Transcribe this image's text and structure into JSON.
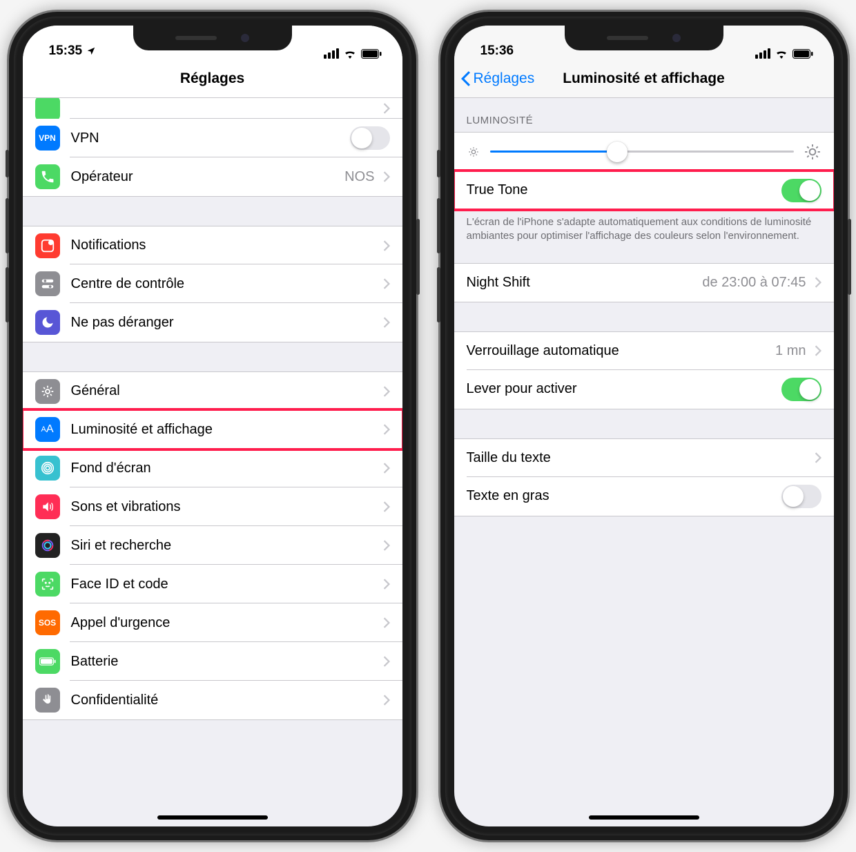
{
  "phone1": {
    "time": "15:35",
    "title": "Réglages",
    "items": {
      "vpn": "VPN",
      "carrier": {
        "label": "Opérateur",
        "value": "NOS"
      },
      "notifications": "Notifications",
      "control_center": "Centre de contrôle",
      "dnd": "Ne pas déranger",
      "general": "Général",
      "display": "Luminosité et affichage",
      "wallpaper": "Fond d'écran",
      "sounds": "Sons et vibrations",
      "siri": "Siri et recherche",
      "faceid": "Face ID et code",
      "sos": "Appel d'urgence",
      "battery": "Batterie",
      "privacy": "Confidentialité"
    },
    "vpn_on": false
  },
  "phone2": {
    "time": "15:36",
    "back": "Réglages",
    "title": "Luminosité et affichage",
    "section_brightness": "LUMINOSITÉ",
    "brightness_percent": 42,
    "truetone": {
      "label": "True Tone",
      "on": true
    },
    "truetone_desc": "L'écran de l'iPhone s'adapte automatiquement aux conditions de luminosité ambiantes pour optimiser l'affichage des couleurs selon l'environnement.",
    "nightshift": {
      "label": "Night Shift",
      "value": "de 23:00 à 07:45"
    },
    "autolock": {
      "label": "Verrouillage automatique",
      "value": "1 mn"
    },
    "raise": {
      "label": "Lever pour activer",
      "on": true
    },
    "textsize": "Taille du texte",
    "boldtext": {
      "label": "Texte en gras",
      "on": false
    }
  },
  "icons": {
    "vpn_text": "VPN",
    "sos_text": "SOS",
    "aa_text": "AA"
  },
  "colors": {
    "blue": "#007aff",
    "green": "#4cd964",
    "red": "#ff3b30",
    "grey": "#8e8e93",
    "orange": "#ff9500",
    "highlight": "#ff1d4d"
  }
}
